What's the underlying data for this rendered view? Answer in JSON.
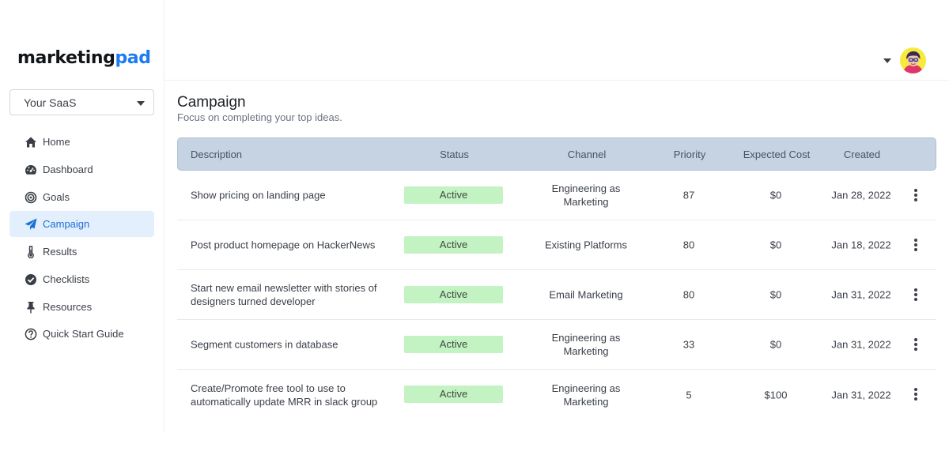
{
  "brand": {
    "part1": "marketing",
    "part2": "pad"
  },
  "workspace": {
    "selected": "Your SaaS"
  },
  "nav": [
    {
      "label": "Home",
      "icon": "home-icon"
    },
    {
      "label": "Dashboard",
      "icon": "dashboard-icon"
    },
    {
      "label": "Goals",
      "icon": "target-icon"
    },
    {
      "label": "Campaign",
      "icon": "paper-plane-icon",
      "active": true
    },
    {
      "label": "Results",
      "icon": "thermometer-icon"
    },
    {
      "label": "Checklists",
      "icon": "check-circle-icon"
    },
    {
      "label": "Resources",
      "icon": "pin-icon"
    },
    {
      "label": "Quick Start Guide",
      "icon": "question-circle-icon"
    }
  ],
  "page": {
    "title": "Campaign",
    "subtitle": "Focus on completing your top ideas."
  },
  "table": {
    "headers": {
      "description": "Description",
      "status": "Status",
      "channel": "Channel",
      "priority": "Priority",
      "cost": "Expected Cost",
      "created": "Created"
    },
    "rows": [
      {
        "description": "Show pricing on landing page",
        "status": "Active",
        "channel": "Engineering as Marketing",
        "priority": "87",
        "cost": "$0",
        "created": "Jan 28, 2022"
      },
      {
        "description": "Post product homepage on HackerNews",
        "status": "Active",
        "channel": "Existing Platforms",
        "priority": "80",
        "cost": "$0",
        "created": "Jan 18, 2022"
      },
      {
        "description": "Start new email newsletter with stories of designers turned developer",
        "status": "Active",
        "channel": "Email Marketing",
        "priority": "80",
        "cost": "$0",
        "created": "Jan 31, 2022"
      },
      {
        "description": "Segment customers in database",
        "status": "Active",
        "channel": "Engineering as Marketing",
        "priority": "33",
        "cost": "$0",
        "created": "Jan 31, 2022"
      },
      {
        "description": "Create/Promote free tool to use to automatically update MRR in slack group",
        "status": "Active",
        "channel": "Engineering as Marketing",
        "priority": "5",
        "cost": "$100",
        "created": "Jan 31, 2022"
      }
    ]
  },
  "colors": {
    "brand_dark": "#111418",
    "brand_accent": "#1a7cf0",
    "active_nav_bg": "#e3effd",
    "header_bg": "#c5d3e3",
    "status_active_bg": "#c3f2c3"
  }
}
